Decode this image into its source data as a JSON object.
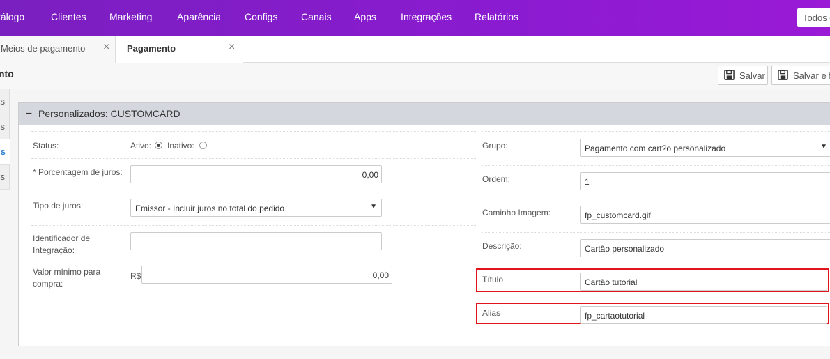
{
  "nav": {
    "items": [
      "tálogo",
      "Clientes",
      "Marketing",
      "Aparência",
      "Configs",
      "Canais",
      "Apps",
      "Integrações",
      "Relatórios"
    ],
    "search_value": "Todos c"
  },
  "tabs": {
    "inactive_label": "Meios de pagamento",
    "active_label": "Pagamento",
    "close_glyph": "×"
  },
  "toolbar": {
    "title": "nto",
    "save_label": "Salvar",
    "save_close_label": "Salvar e fe"
  },
  "sidemenu": {
    "items": [
      "s",
      "s",
      "s",
      "s"
    ],
    "active_index": 2
  },
  "panel": {
    "collapse_glyph": "–",
    "title": "Personalizados: CUSTOMCARD",
    "left": {
      "status_label": "Status:",
      "active_label": "Ativo:",
      "inactive_label": "Inativo:",
      "interest_label": "* Porcentagem de juros:",
      "interest_value": "0,00",
      "interest_type_label": "Tipo de juros:",
      "interest_type_value": "Emissor - Incluir juros no total do pedido",
      "integration_label_1": "Identificador de",
      "integration_label_2": "Integração:",
      "integration_value": "",
      "min_label_1": "Valor mínimo para",
      "min_label_2": "compra:",
      "currency": "R$",
      "min_value": "0,00"
    },
    "right": {
      "group_label": "Grupo:",
      "group_value": "Pagamento com cart?o personalizado",
      "order_label": "Ordem:",
      "order_value": "1",
      "image_label": "Caminho Imagem:",
      "image_value": "fp_customcard.gif",
      "description_label": "Descrição:",
      "description_value": "Cartão personalizado",
      "title_label": "Título",
      "title_value": "Cartão tutorial",
      "alias_label": "Alias",
      "alias_value": "fp_cartaotutorial"
    }
  },
  "colors": {
    "nav_gradient_start": "#7a1fc0",
    "nav_gradient_end": "#9a1ad6",
    "highlight": "#e0141b",
    "panel_header": "#d4d8de"
  },
  "icons": {
    "save": "floppy-disk-icon",
    "caret": "▼"
  }
}
